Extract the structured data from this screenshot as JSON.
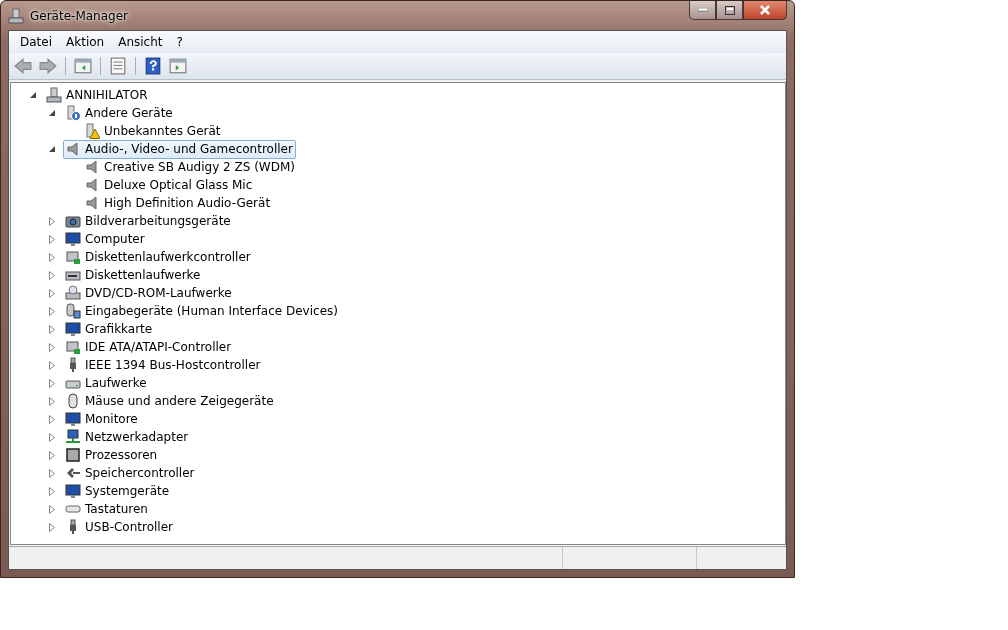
{
  "window": {
    "title": "Geräte-Manager"
  },
  "menu": [
    {
      "label": "Datei"
    },
    {
      "label": "Aktion"
    },
    {
      "label": "Ansicht"
    },
    {
      "label": "?"
    }
  ],
  "toolbar": [
    {
      "kind": "back",
      "disabled": true
    },
    {
      "kind": "forward",
      "disabled": true
    },
    {
      "kind": "tree-pane",
      "disabled": false
    },
    {
      "kind": "properties",
      "disabled": false
    },
    {
      "kind": "help",
      "disabled": false
    },
    {
      "kind": "action-pane",
      "disabled": false
    }
  ],
  "tree": [
    {
      "label": "ANNIHILATOR",
      "kind": "computer",
      "expanded": true,
      "selected": false,
      "children": [
        {
          "label": "Andere Geräte",
          "kind": "unknown",
          "expanded": true,
          "selected": false,
          "children": [
            {
              "label": "Unbekanntes Gerät",
              "kind": "warning",
              "selected": false
            }
          ]
        },
        {
          "label": "Audio-, Video- und Gamecontroller",
          "kind": "speaker",
          "expanded": true,
          "selected": true,
          "children": [
            {
              "label": "Creative SB Audigy 2 ZS (WDM)",
              "kind": "speaker",
              "selected": false
            },
            {
              "label": "Deluxe Optical Glass Mic",
              "kind": "speaker",
              "selected": false
            },
            {
              "label": "High Definition Audio-Gerät",
              "kind": "speaker",
              "selected": false
            }
          ]
        },
        {
          "label": "Bildverarbeitungsgeräte",
          "kind": "camera",
          "expanded": false,
          "selected": false
        },
        {
          "label": "Computer",
          "kind": "monitor",
          "expanded": false,
          "selected": false
        },
        {
          "label": "Diskettenlaufwerkcontroller",
          "kind": "controller",
          "expanded": false,
          "selected": false
        },
        {
          "label": "Diskettenlaufwerke",
          "kind": "floppy",
          "expanded": false,
          "selected": false
        },
        {
          "label": "DVD/CD-ROM-Laufwerke",
          "kind": "dvd",
          "expanded": false,
          "selected": false
        },
        {
          "label": "Eingabegeräte (Human Interface Devices)",
          "kind": "hid",
          "expanded": false,
          "selected": false
        },
        {
          "label": "Grafikkarte",
          "kind": "monitor",
          "expanded": false,
          "selected": false
        },
        {
          "label": "IDE ATA/ATAPI-Controller",
          "kind": "controller",
          "expanded": false,
          "selected": false
        },
        {
          "label": "IEEE 1394 Bus-Hostcontroller",
          "kind": "plug",
          "expanded": false,
          "selected": false
        },
        {
          "label": "Laufwerke",
          "kind": "drive",
          "expanded": false,
          "selected": false
        },
        {
          "label": "Mäuse und andere Zeigegeräte",
          "kind": "mouse",
          "expanded": false,
          "selected": false
        },
        {
          "label": "Monitore",
          "kind": "monitor",
          "expanded": false,
          "selected": false
        },
        {
          "label": "Netzwerkadapter",
          "kind": "network",
          "expanded": false,
          "selected": false
        },
        {
          "label": "Prozessoren",
          "kind": "chip",
          "expanded": false,
          "selected": false
        },
        {
          "label": "Speichercontroller",
          "kind": "storage",
          "expanded": false,
          "selected": false
        },
        {
          "label": "Systemgeräte",
          "kind": "monitor",
          "expanded": false,
          "selected": false
        },
        {
          "label": "Tastaturen",
          "kind": "keyboard",
          "expanded": false,
          "selected": false
        },
        {
          "label": "USB-Controller",
          "kind": "plug",
          "expanded": false,
          "selected": false
        }
      ]
    }
  ]
}
